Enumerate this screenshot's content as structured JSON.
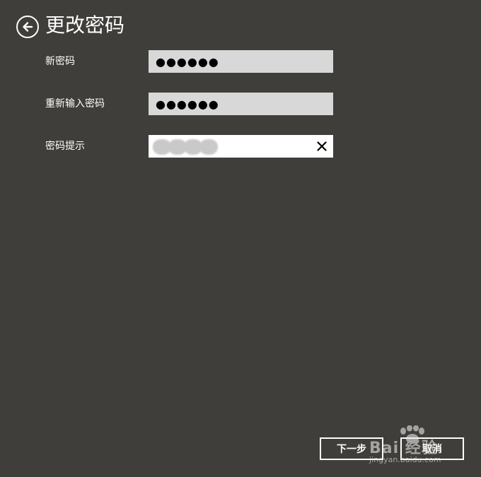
{
  "header": {
    "title": "更改密码",
    "back_icon": "arrow-left-circle-icon"
  },
  "form": {
    "new_password": {
      "label": "新密码",
      "value": "●●●●●●"
    },
    "confirm_password": {
      "label": "重新输入密码",
      "value": "●●●●●●"
    },
    "password_hint": {
      "label": "密码提示",
      "value": "",
      "clear_icon": "close-icon"
    }
  },
  "footer": {
    "next_label": "下一步",
    "cancel_label": "取消"
  },
  "watermark": {
    "text": "Bai 经验",
    "url": "jingyan.baidu.com"
  },
  "colors": {
    "background": "#403e3a",
    "field_background": "#d8d8d8",
    "text": "#ffffff"
  }
}
